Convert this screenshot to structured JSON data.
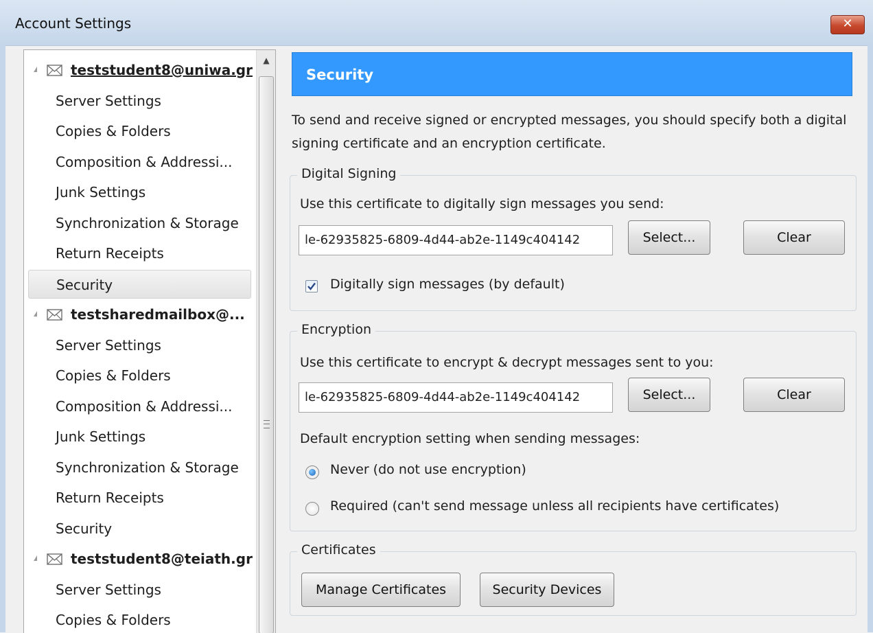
{
  "window": {
    "title": "Account Settings",
    "close_label": "✕"
  },
  "tree": {
    "items": [
      {
        "kind": "account",
        "label": "teststudent8@uniwa.gr",
        "focused": true
      },
      {
        "kind": "child",
        "label": "Server Settings"
      },
      {
        "kind": "child",
        "label": "Copies & Folders"
      },
      {
        "kind": "child",
        "label": "Composition & Addressi..."
      },
      {
        "kind": "child",
        "label": "Junk Settings"
      },
      {
        "kind": "child",
        "label": "Synchronization & Storage"
      },
      {
        "kind": "child",
        "label": "Return Receipts"
      },
      {
        "kind": "child",
        "label": "Security",
        "selected": true
      },
      {
        "kind": "account",
        "label": "testsharedmailbox@..."
      },
      {
        "kind": "child",
        "label": "Server Settings"
      },
      {
        "kind": "child",
        "label": "Copies & Folders"
      },
      {
        "kind": "child",
        "label": "Composition & Addressi..."
      },
      {
        "kind": "child",
        "label": "Junk Settings"
      },
      {
        "kind": "child",
        "label": "Synchronization & Storage"
      },
      {
        "kind": "child",
        "label": "Return Receipts"
      },
      {
        "kind": "child",
        "label": "Security"
      },
      {
        "kind": "account",
        "label": "teststudent8@teiath.gr"
      },
      {
        "kind": "child",
        "label": "Server Settings"
      },
      {
        "kind": "child",
        "label": "Copies & Folders"
      }
    ]
  },
  "security": {
    "title": "Security",
    "intro": "To send and receive signed or encrypted messages, you should specify both a digital signing certificate and an encryption certificate.",
    "signing": {
      "legend": "Digital Signing",
      "label": "Use this certificate to digitally sign messages you send:",
      "certificate": "le-62935825-6809-4d44-ab2e-1149c404142",
      "select_label": "Select...",
      "clear_label": "Clear",
      "sign_default_label": "Digitally sign messages (by default)",
      "sign_default_checked": true
    },
    "encryption": {
      "legend": "Encryption",
      "label": "Use this certificate to encrypt & decrypt messages sent to you:",
      "certificate": "le-62935825-6809-4d44-ab2e-1149c404142",
      "select_label": "Select...",
      "clear_label": "Clear",
      "default_label": "Default encryption setting when sending messages:",
      "never_label": "Never (do not use encryption)",
      "required_label": "Required (can't send message unless all recipients have certificates)",
      "selected": "never"
    },
    "certificates": {
      "legend": "Certificates",
      "manage_label": "Manage Certificates",
      "devices_label": "Security Devices"
    }
  }
}
